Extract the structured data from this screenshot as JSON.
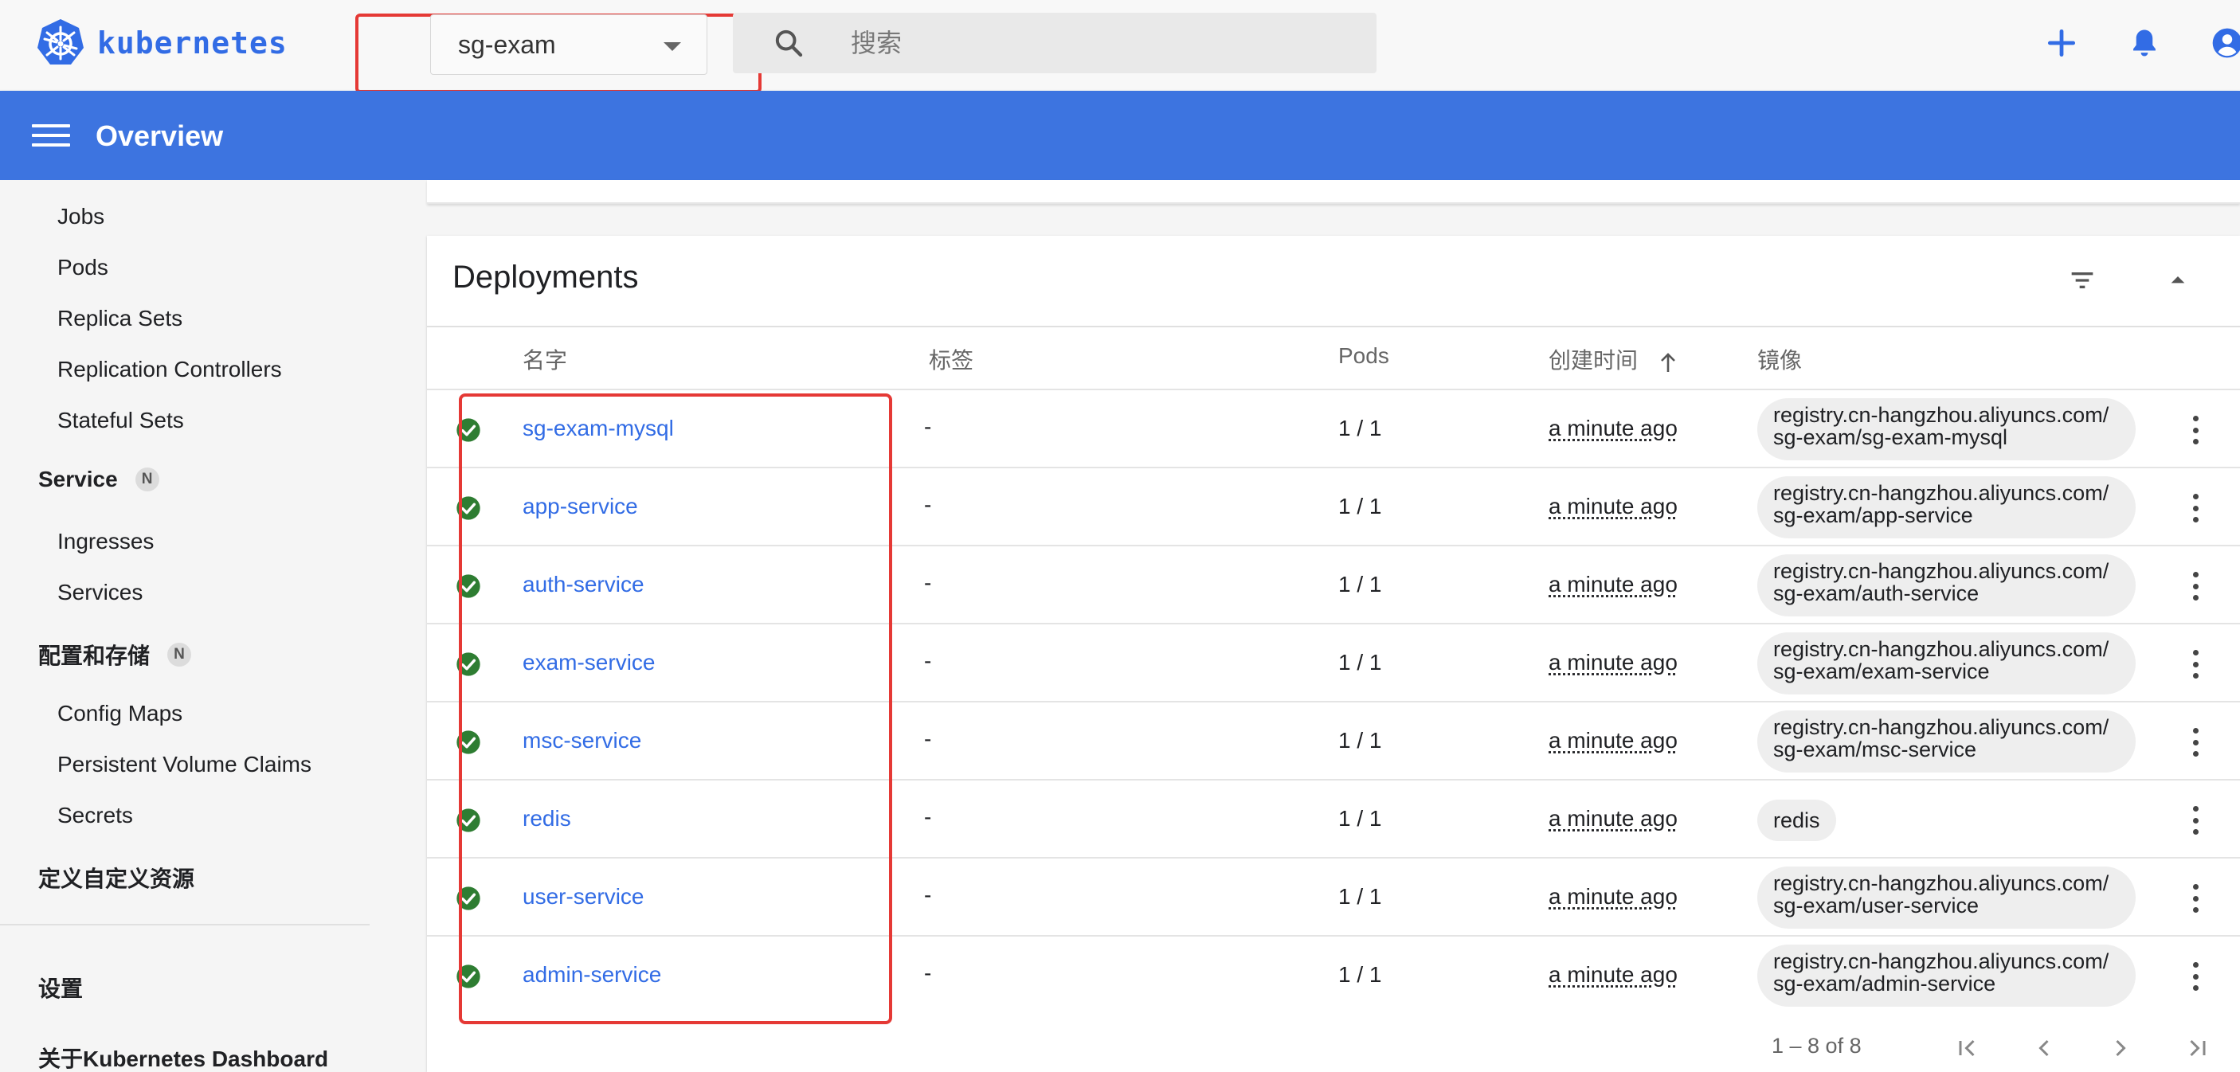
{
  "app": {
    "name": "kubernetes",
    "brand_color": "#326ce5",
    "header_color": "#3d74e0",
    "highlight_color": "#e53935"
  },
  "namespace_selector": {
    "value": "sg-exam"
  },
  "search": {
    "placeholder": "搜索"
  },
  "top_actions": [
    {
      "icon": "plus-icon"
    },
    {
      "icon": "bell-icon"
    },
    {
      "icon": "account-icon"
    }
  ],
  "page_title": "Overview",
  "sidebar": {
    "items": [
      {
        "label": "Jobs"
      },
      {
        "label": "Pods"
      },
      {
        "label": "Replica Sets"
      },
      {
        "label": "Replication Controllers"
      },
      {
        "label": "Stateful Sets"
      }
    ],
    "service_section": {
      "label": "Service",
      "badge": "N"
    },
    "service_items": [
      {
        "label": "Ingresses"
      },
      {
        "label": "Services"
      }
    ],
    "config_section": {
      "label": "配置和存储",
      "badge": "N"
    },
    "config_items": [
      {
        "label": "Config Maps"
      },
      {
        "label": "Persistent Volume Claims"
      },
      {
        "label": "Secrets"
      }
    ],
    "crd_label": "定义自定义资源",
    "settings_label": "设置",
    "about_label": "关于Kubernetes Dashboard"
  },
  "deployments": {
    "title": "Deployments",
    "columns": {
      "name": "名字",
      "labels": "标签",
      "pods": "Pods",
      "created": "创建时间",
      "images": "镜像"
    },
    "sort": {
      "column": "created",
      "direction": "up"
    },
    "rows": [
      {
        "name": "sg-exam-mysql",
        "labels": "-",
        "pods": "1 / 1",
        "created": "a minute ago",
        "image_line1": "registry.cn-hangzhou.aliyuncs.com/",
        "image_line2": "sg-exam/sg-exam-mysql",
        "status": "running"
      },
      {
        "name": "app-service",
        "labels": "-",
        "pods": "1 / 1",
        "created": "a minute ago",
        "image_line1": "registry.cn-hangzhou.aliyuncs.com/",
        "image_line2": "sg-exam/app-service",
        "status": "running"
      },
      {
        "name": "auth-service",
        "labels": "-",
        "pods": "1 / 1",
        "created": "a minute ago",
        "image_line1": "registry.cn-hangzhou.aliyuncs.com/",
        "image_line2": "sg-exam/auth-service",
        "status": "running"
      },
      {
        "name": "exam-service",
        "labels": "-",
        "pods": "1 / 1",
        "created": "a minute ago",
        "image_line1": "registry.cn-hangzhou.aliyuncs.com/",
        "image_line2": "sg-exam/exam-service",
        "status": "running"
      },
      {
        "name": "msc-service",
        "labels": "-",
        "pods": "1 / 1",
        "created": "a minute ago",
        "image_line1": "registry.cn-hangzhou.aliyuncs.com/",
        "image_line2": "sg-exam/msc-service",
        "status": "running"
      },
      {
        "name": "redis",
        "labels": "-",
        "pods": "1 / 1",
        "created": "a minute ago",
        "image_line1": "redis",
        "image_line2": "",
        "status": "running"
      },
      {
        "name": "user-service",
        "labels": "-",
        "pods": "1 / 1",
        "created": "a minute ago",
        "image_line1": "registry.cn-hangzhou.aliyuncs.com/",
        "image_line2": "sg-exam/user-service",
        "status": "running"
      },
      {
        "name": "admin-service",
        "labels": "-",
        "pods": "1 / 1",
        "created": "a minute ago",
        "image_line1": "registry.cn-hangzhou.aliyuncs.com/",
        "image_line2": "sg-exam/admin-service",
        "status": "running"
      }
    ],
    "pagination": {
      "range": "1 – 8 of 8"
    }
  }
}
